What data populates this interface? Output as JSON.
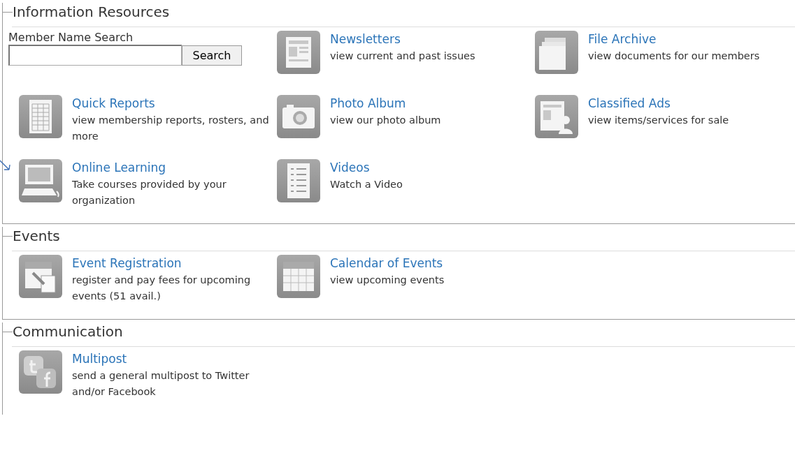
{
  "sections": [
    {
      "title": "Information Resources",
      "items": [
        {
          "kind": "search",
          "label": "Member Name Search",
          "button": "Search"
        },
        {
          "kind": "newspaper",
          "title": "Newsletters",
          "description": "view current and past issues"
        },
        {
          "kind": "folders",
          "title": "File Archive",
          "description": "view documents for our members"
        },
        {
          "kind": "spreadsheet",
          "title": "Quick Reports",
          "description": "view membership reports, rosters, and more"
        },
        {
          "kind": "camera",
          "title": "Photo Album",
          "description": "view our photo album"
        },
        {
          "kind": "classified",
          "title": "Classified Ads",
          "description": "view items/services for sale"
        },
        {
          "kind": "computer",
          "title": "Online Learning",
          "description": "Take courses provided by your organization"
        },
        {
          "kind": "checklist",
          "title": "Videos",
          "description": "Watch a Video"
        }
      ]
    },
    {
      "title": "Events",
      "items": [
        {
          "kind": "calendar-form",
          "title": "Event Registration",
          "description": "register and pay fees for upcoming events (51 avail.)"
        },
        {
          "kind": "calendar",
          "title": "Calendar of Events",
          "description": "view upcoming events"
        }
      ]
    },
    {
      "title": "Communication",
      "items": [
        {
          "kind": "social",
          "title": "Multipost",
          "description": "send a general multipost to Twitter and/or Facebook"
        }
      ]
    }
  ]
}
